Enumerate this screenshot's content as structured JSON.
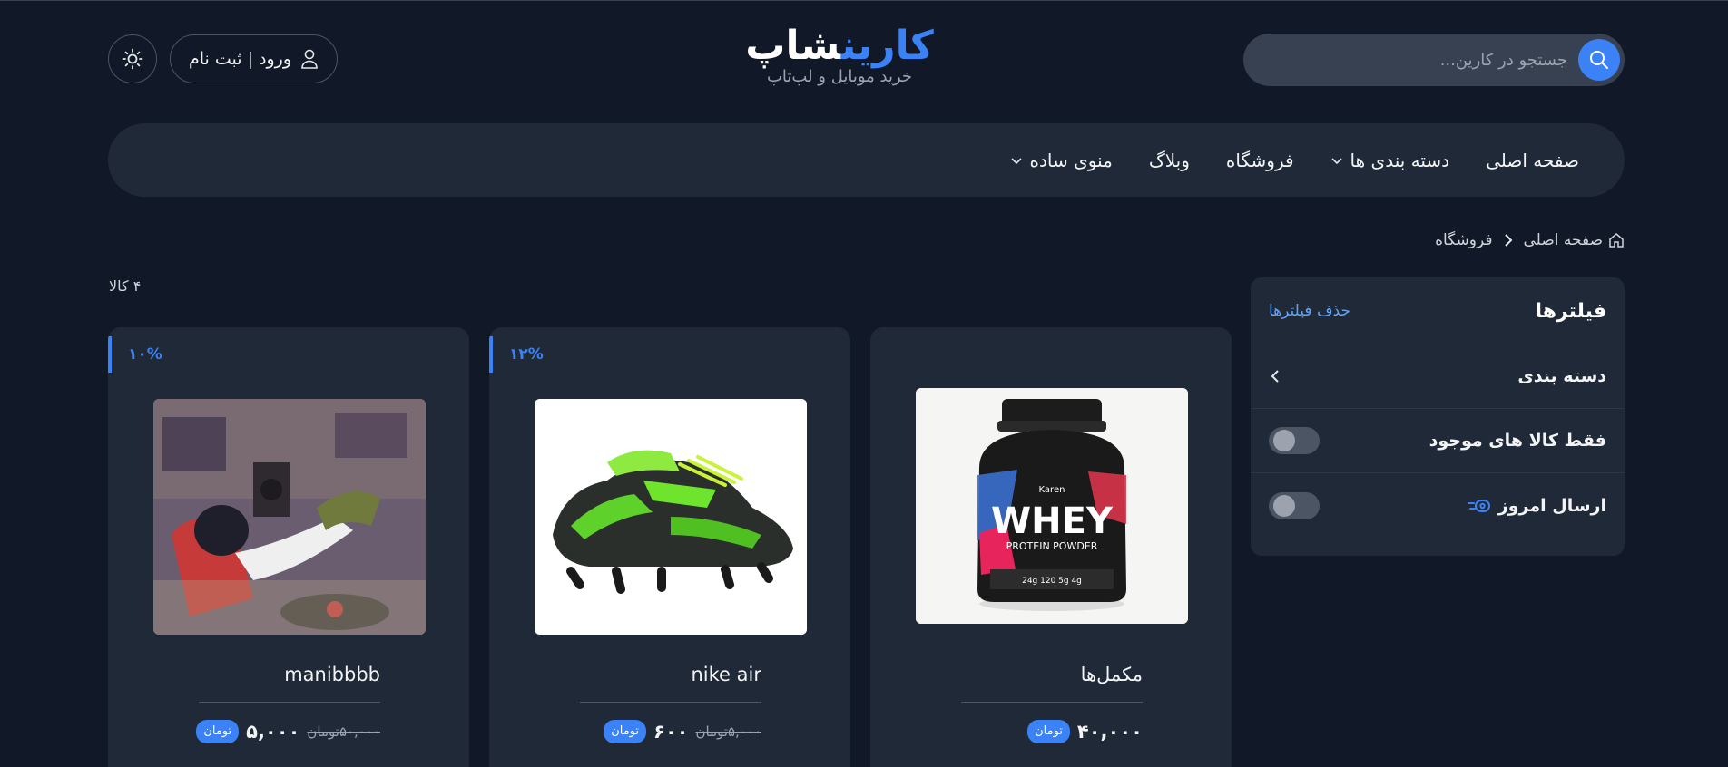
{
  "header": {
    "search_placeholder": "جستجو در کارین...",
    "logo_part_blue": "کارین",
    "logo_part_white": "شاپ",
    "logo_subtitle": "خرید موبایل و لپ‌تاپ",
    "auth_label": "ورود | ثبت نام"
  },
  "nav": {
    "items": [
      {
        "label": "صفحه اصلی"
      },
      {
        "label": "دسته بندی ها"
      },
      {
        "label": "فروشگاه"
      },
      {
        "label": "وبلاگ"
      },
      {
        "label": "منوی ساده"
      }
    ]
  },
  "breadcrumb": {
    "home": "صفحه اصلی",
    "current": "فروشگاه"
  },
  "filters": {
    "title": "فیلترها",
    "clear": "حذف فیلترها",
    "category": "دسته بندی",
    "in_stock": "فقط کالا های موجود",
    "today_shipping": "ارسال امروز"
  },
  "results": {
    "count": "۴ کالا"
  },
  "products": [
    {
      "name": "مکمل‌ها",
      "price": "۴۰,۰۰۰",
      "currency": "تومان",
      "discount": ""
    },
    {
      "name": "nike air",
      "price": "۶۰۰",
      "old_price": "۵,۰۰۰تومان",
      "currency": "تومان",
      "discount": "۱۲%"
    },
    {
      "name": "manibbbb",
      "price": "۵,۰۰۰",
      "old_price": "۵۰,۰۰۰تومان",
      "currency": "تومان",
      "discount": "۱۰%"
    }
  ],
  "colors": {
    "accent": "#3b82f6",
    "background": "#111827",
    "surface": "#1f2937"
  }
}
